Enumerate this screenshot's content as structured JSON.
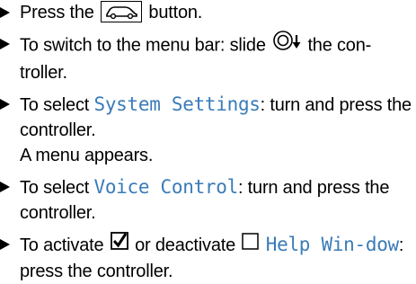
{
  "steps": [
    {
      "before": "Press the ",
      "icon": "car-button-icon",
      "after": " button."
    },
    {
      "before": "To switch to the menu bar: slide ",
      "icon": "controller-slide-down-icon",
      "after": " the con-troller."
    },
    {
      "before": "To select ",
      "highlight": "System Settings",
      "after": ": turn and press the controller.",
      "note": "A menu appears."
    },
    {
      "before": "To select ",
      "highlight": "Voice Control",
      "after": ": turn and press the controller."
    },
    {
      "before": "To activate ",
      "icon_checked": "checkbox-checked-icon",
      "middle": " or deactivate ",
      "icon_unchecked": "checkbox-unchecked-icon",
      "highlight": "Help Win-dow",
      "after": ": press the controller."
    }
  ],
  "colors": {
    "highlight": "#3a7bb8",
    "text": "#000000"
  }
}
